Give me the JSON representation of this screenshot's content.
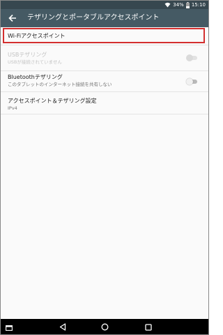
{
  "status_bar": {
    "battery_percent": "34%",
    "time": "15:10"
  },
  "app_bar": {
    "title": "テザリングとポータブルアクセスポイント"
  },
  "settings": {
    "wifi_hotspot": {
      "title": "Wi-Fiアクセスポイント"
    },
    "usb_tethering": {
      "title": "USBテザリング",
      "summary": "USBが接続されていません",
      "enabled": false,
      "checked": false
    },
    "bluetooth_tethering": {
      "title": "Bluetoothテザリング",
      "summary": "このタブレットのインターネット接続を共有しない",
      "enabled": true,
      "checked": false
    },
    "hotspot_settings": {
      "title": "アクセスポイント＆テザリング設定",
      "summary": "IPv4"
    }
  },
  "colors": {
    "status_bar": "#37474f",
    "app_bar": "#455a64",
    "highlight": "#d32f2f"
  }
}
